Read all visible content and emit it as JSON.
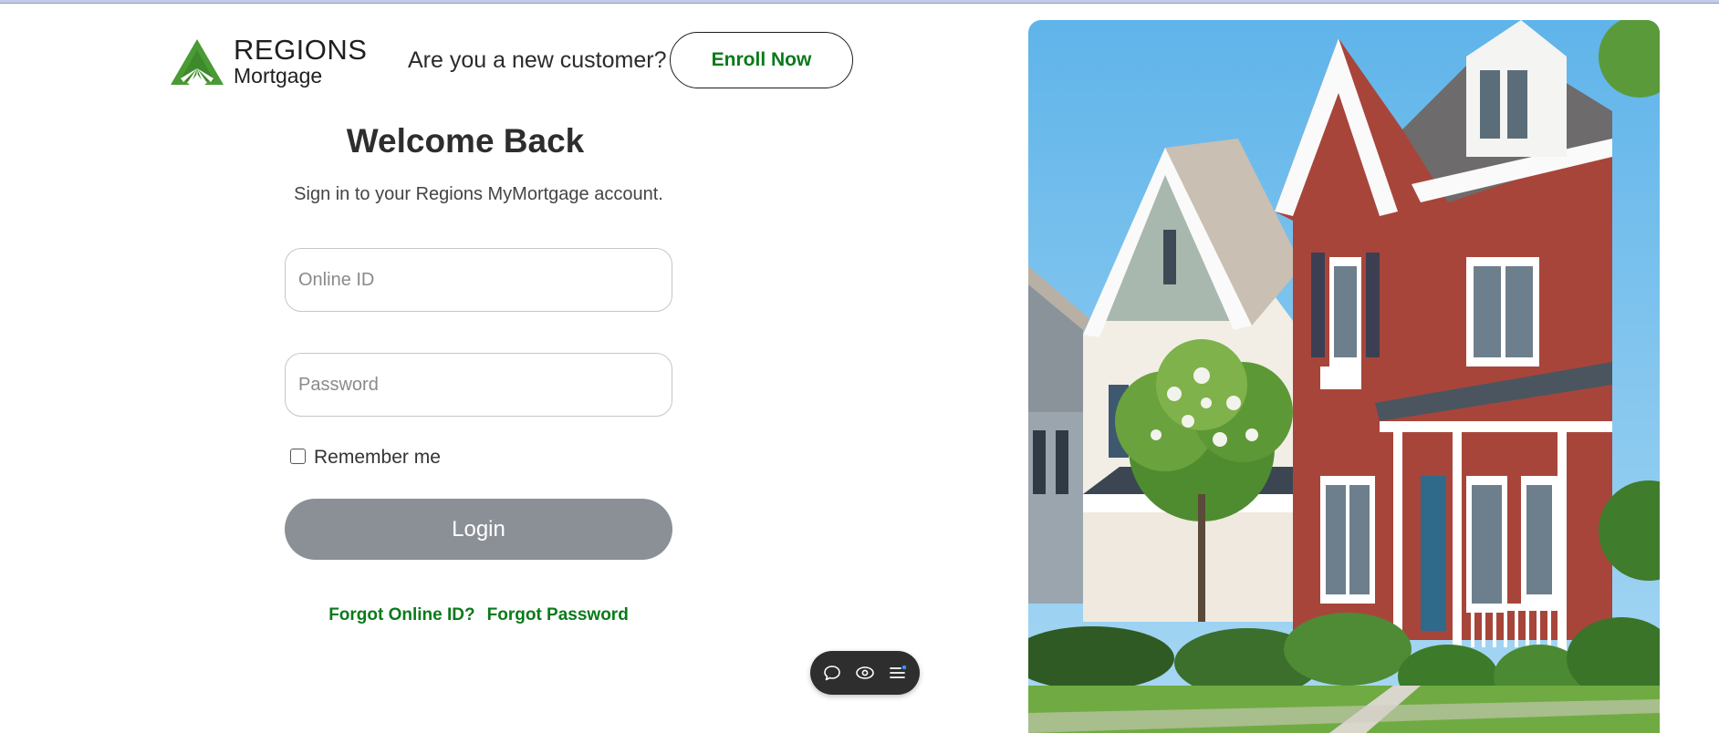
{
  "brand": {
    "name_line1": "REGIONS",
    "name_line2": "Mortgage",
    "green": "#3f8f2f"
  },
  "header": {
    "new_customer_text": "Are you a new customer?",
    "enroll_label": "Enroll Now"
  },
  "login": {
    "title": "Welcome Back",
    "subtitle": "Sign in to your Regions MyMortgage account.",
    "online_id_placeholder": "Online ID",
    "online_id_value": "",
    "password_placeholder": "Password",
    "password_value": "",
    "remember_label": "Remember me",
    "remember_checked": false,
    "login_label": "Login",
    "forgot_id_label": "Forgot Online ID?",
    "forgot_password_label": "Forgot Password"
  },
  "toolbar": {
    "icons": [
      "chat-bubble-icon",
      "eye-icon",
      "menu-list-icon"
    ]
  },
  "hero": {
    "description_icon": "house-photo"
  },
  "colors": {
    "accent_green": "#0a7a1a",
    "login_button": "#8b9097",
    "toolbar_bg": "#2e2e2e"
  }
}
